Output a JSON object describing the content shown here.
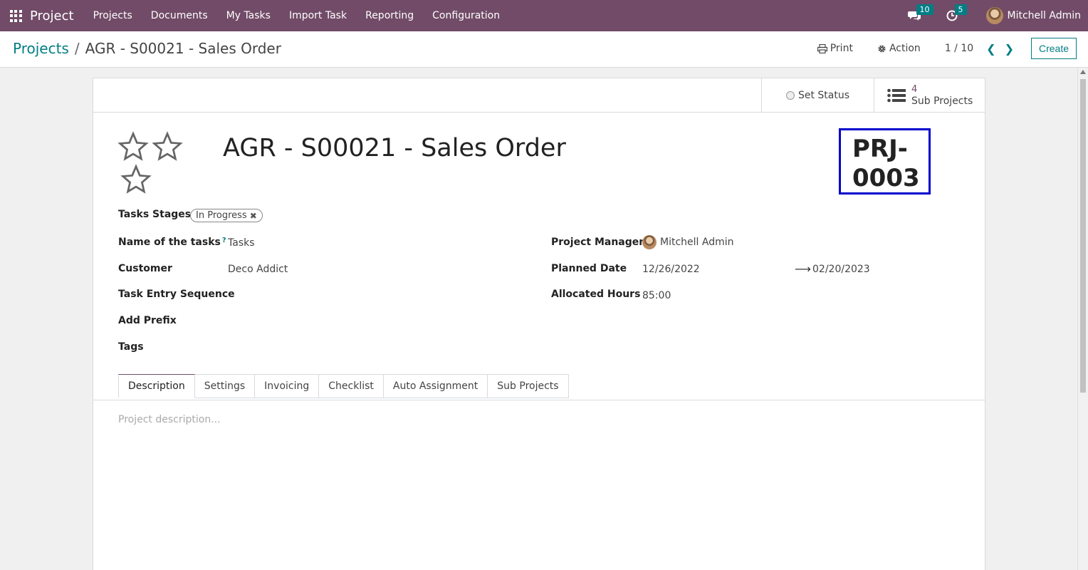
{
  "navbar": {
    "app_name": "Project",
    "menu": [
      "Projects",
      "Documents",
      "My Tasks",
      "Import Task",
      "Reporting",
      "Configuration"
    ],
    "messages_count": "10",
    "activities_count": "5",
    "user_name": "Mitchell Admin"
  },
  "control_panel": {
    "breadcrumb_parent": "Projects",
    "breadcrumb_sep": "/",
    "breadcrumb_current": "AGR - S00021 - Sales Order",
    "print_label": "Print",
    "action_label": "Action",
    "pager": "1 / 10",
    "create_label": "Create"
  },
  "button_box": {
    "set_status_label": "Set Status",
    "sub_projects_count": "4",
    "sub_projects_label": "Sub Projects"
  },
  "form": {
    "title": "AGR - S00021 - Sales Order",
    "reference_line1": "PRJ-",
    "reference_line2": "0003",
    "priority_stars": 0,
    "labels": {
      "tasks_stages": "Tasks Stages",
      "name_of_tasks": "Name of the tasks",
      "customer": "Customer",
      "task_entry_sequence": "Task Entry Sequence",
      "add_prefix": "Add Prefix",
      "tags": "Tags",
      "project_manager": "Project Manager",
      "planned_date": "Planned Date",
      "allocated_hours": "Allocated Hours"
    },
    "help_mark": "?",
    "tasks_stage_tag": "In Progress",
    "name_of_tasks": "Tasks",
    "customer": "Deco Addict",
    "project_manager": "Mitchell Admin",
    "planned_date_start": "12/26/2022",
    "planned_date_end": "02/20/2023",
    "allocated_hours": "85:00"
  },
  "tabs": [
    "Description",
    "Settings",
    "Invoicing",
    "Checklist",
    "Auto Assignment",
    "Sub Projects"
  ],
  "active_tab": "Description",
  "description_placeholder": "Project description...",
  "colors": {
    "navbar": "#714b67",
    "accent": "#017e84",
    "reference_border": "#0000cc"
  }
}
